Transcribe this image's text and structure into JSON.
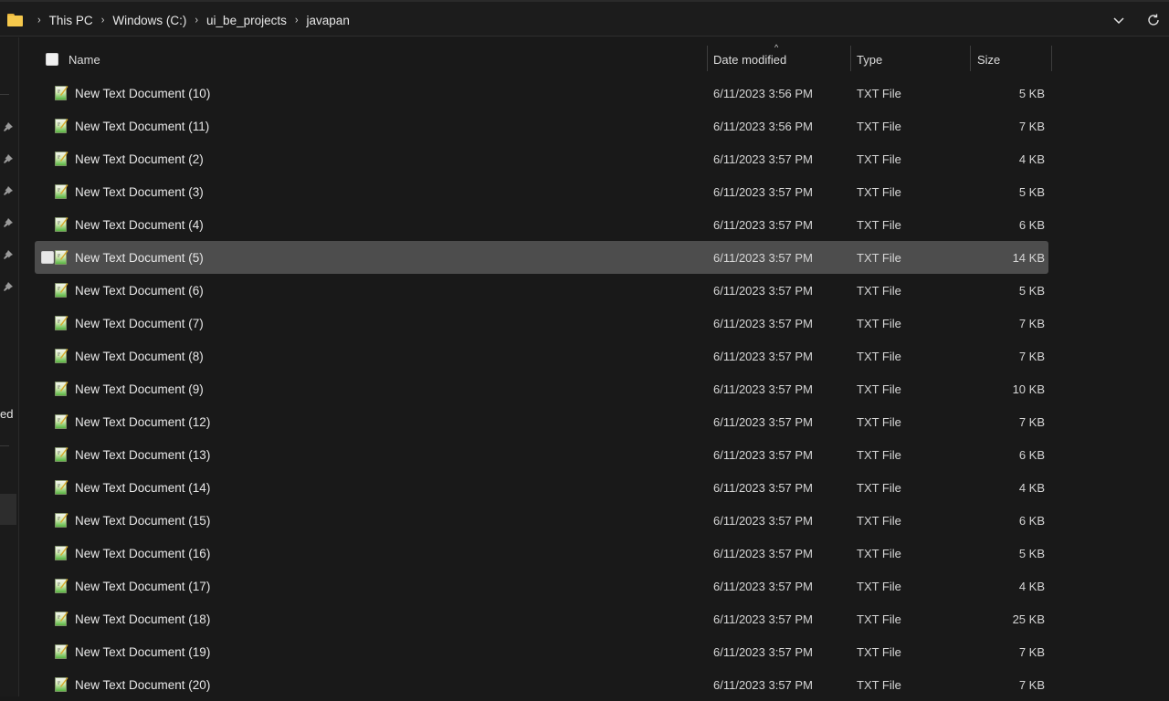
{
  "breadcrumb": {
    "icon": "folder-icon",
    "items": [
      "This PC",
      "Windows (C:)",
      "ui_be_projects",
      "javapan"
    ],
    "separator": "›"
  },
  "toolbar": {
    "history_dropdown_icon": "chevron-down-icon",
    "refresh_icon": "refresh-icon"
  },
  "nav_pane": {
    "pinned_count": 6,
    "truncated_label": "ed"
  },
  "columns": {
    "name": "Name",
    "date_modified": "Date modified",
    "type": "Type",
    "size": "Size",
    "sorted_by": "Date modified",
    "sort_direction": "ascending"
  },
  "files": [
    {
      "name": "New Text Document (10)",
      "date": "6/11/2023 3:56 PM",
      "type": "TXT File",
      "size": "5 KB",
      "selected": false
    },
    {
      "name": "New Text Document (11)",
      "date": "6/11/2023 3:56 PM",
      "type": "TXT File",
      "size": "7 KB",
      "selected": false
    },
    {
      "name": "New Text Document (2)",
      "date": "6/11/2023 3:57 PM",
      "type": "TXT File",
      "size": "4 KB",
      "selected": false
    },
    {
      "name": "New Text Document (3)",
      "date": "6/11/2023 3:57 PM",
      "type": "TXT File",
      "size": "5 KB",
      "selected": false
    },
    {
      "name": "New Text Document (4)",
      "date": "6/11/2023 3:57 PM",
      "type": "TXT File",
      "size": "6 KB",
      "selected": false
    },
    {
      "name": "New Text Document (5)",
      "date": "6/11/2023 3:57 PM",
      "type": "TXT File",
      "size": "14 KB",
      "selected": true
    },
    {
      "name": "New Text Document (6)",
      "date": "6/11/2023 3:57 PM",
      "type": "TXT File",
      "size": "5 KB",
      "selected": false
    },
    {
      "name": "New Text Document (7)",
      "date": "6/11/2023 3:57 PM",
      "type": "TXT File",
      "size": "7 KB",
      "selected": false
    },
    {
      "name": "New Text Document (8)",
      "date": "6/11/2023 3:57 PM",
      "type": "TXT File",
      "size": "7 KB",
      "selected": false
    },
    {
      "name": "New Text Document (9)",
      "date": "6/11/2023 3:57 PM",
      "type": "TXT File",
      "size": "10 KB",
      "selected": false
    },
    {
      "name": "New Text Document (12)",
      "date": "6/11/2023 3:57 PM",
      "type": "TXT File",
      "size": "7 KB",
      "selected": false
    },
    {
      "name": "New Text Document (13)",
      "date": "6/11/2023 3:57 PM",
      "type": "TXT File",
      "size": "6 KB",
      "selected": false
    },
    {
      "name": "New Text Document (14)",
      "date": "6/11/2023 3:57 PM",
      "type": "TXT File",
      "size": "4 KB",
      "selected": false
    },
    {
      "name": "New Text Document (15)",
      "date": "6/11/2023 3:57 PM",
      "type": "TXT File",
      "size": "6 KB",
      "selected": false
    },
    {
      "name": "New Text Document (16)",
      "date": "6/11/2023 3:57 PM",
      "type": "TXT File",
      "size": "5 KB",
      "selected": false
    },
    {
      "name": "New Text Document (17)",
      "date": "6/11/2023 3:57 PM",
      "type": "TXT File",
      "size": "4 KB",
      "selected": false
    },
    {
      "name": "New Text Document (18)",
      "date": "6/11/2023 3:57 PM",
      "type": "TXT File",
      "size": "25 KB",
      "selected": false
    },
    {
      "name": "New Text Document (19)",
      "date": "6/11/2023 3:57 PM",
      "type": "TXT File",
      "size": "7 KB",
      "selected": false
    },
    {
      "name": "New Text Document (20)",
      "date": "6/11/2023 3:57 PM",
      "type": "TXT File",
      "size": "7 KB",
      "selected": false
    }
  ],
  "colors": {
    "background": "#191919",
    "selected_row": "#4d4d4d",
    "folder": "#f5c84c"
  }
}
